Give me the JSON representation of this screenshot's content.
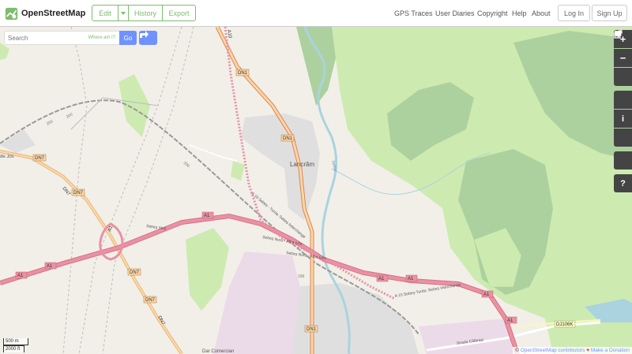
{
  "header": {
    "brand": "OpenStreetMap",
    "edit": "Edit",
    "history": "History",
    "export": "Export",
    "nav": [
      "GPS Traces",
      "User Diaries",
      "Copyright",
      "Help",
      "About"
    ],
    "login": "Log In",
    "signup": "Sign Up"
  },
  "search": {
    "placeholder": "Search",
    "where_am_i": "Where am I?",
    "go": "Go"
  },
  "map": {
    "labels": {
      "dn1_top": "DN1",
      "dn1_mid": "DN1",
      "dn1_bottom": "DN1",
      "dn7_1": "DN7",
      "dn7_2": "DN7",
      "dn7_3": "DN7",
      "dn7_4": "DN7",
      "dn7_5": "DN7",
      "dn7_6": "DN7",
      "a1_1": "A1",
      "a1_2": "A1",
      "a1_3": "A1",
      "a1_4": "A1",
      "a1_5": "A1",
      "a1_6": "A1",
      "a1_7": "A1",
      "a1_8": "A1",
      "a10_top": "A10",
      "dj106k": "DJ106K",
      "lancram": "Lancrăm",
      "sebes_vest": "Sebeș Vest",
      "sebes_nord_1": "Sebeș Nord - Alba Iulia",
      "sebes_nord_2": "Sebeș Nord - Alba Iulia",
      "interchange_1": "A 10 Sebeș - Turda: Sebeș Interchange",
      "interchange_2": "A 10 Sebeș-Turda: Sebeș Interchange",
      "strada_calarasi": "Strada Călărași",
      "sebes_river": "Sebeș",
      "num_200_a": "200",
      "num_200_b": "200",
      "num_200_c": "200",
      "num_100": "100",
      "de_jos": "de Jos",
      "bottom_place": "Dar Comercian"
    }
  },
  "scale": {
    "metric": "500 m",
    "imperial": "2000 ft"
  },
  "attribution": {
    "prefix": "©",
    "osm": "OpenStreetMap contributors",
    "heart": "♥",
    "donate": "Make a Donation"
  },
  "colors": {
    "accent": "#7ebc6f",
    "button_blue": "#7092ff",
    "motorway": "#e892a2",
    "primary": "#fcd6a4",
    "land": "#f2efe9",
    "forest": "#add19e",
    "meadow": "#cdebb0",
    "residential": "#e0dfdf",
    "water": "#aad3df"
  }
}
